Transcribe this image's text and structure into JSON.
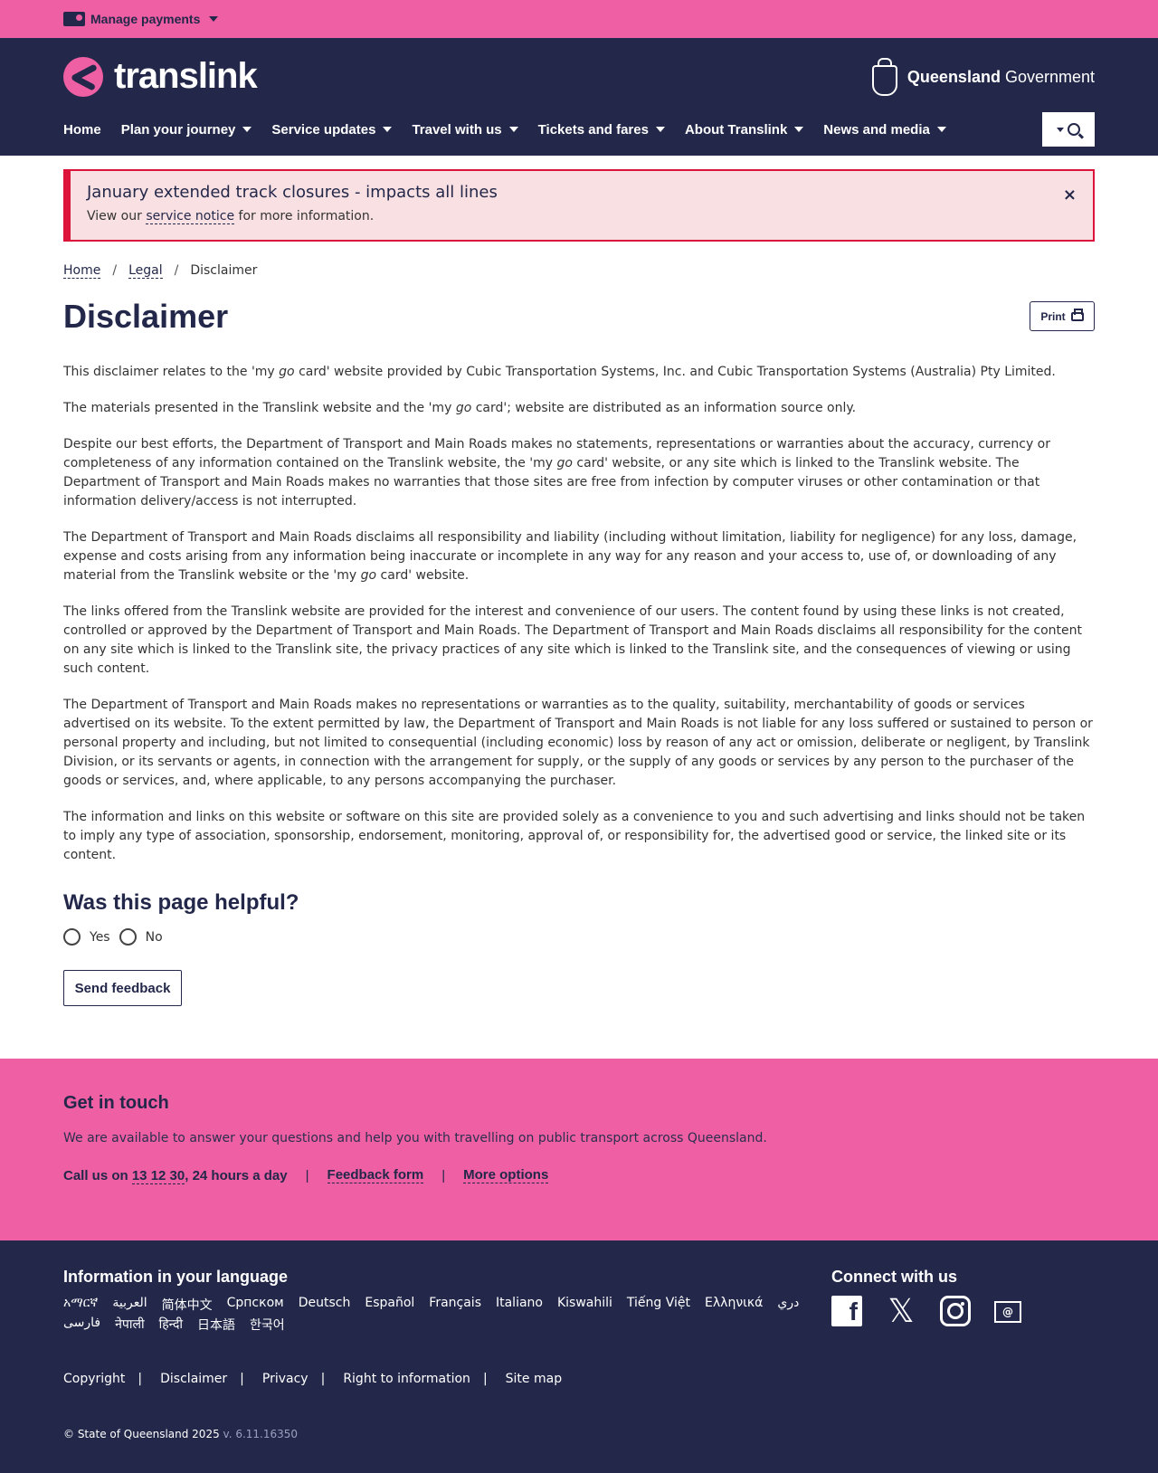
{
  "topbar": {
    "manage_payments": "Manage payments"
  },
  "header": {
    "logo_text": "translink",
    "gov_bold": "Queensland",
    "gov_rest": " Government",
    "nav": [
      {
        "label": "Home",
        "has_dropdown": false
      },
      {
        "label": "Plan your journey",
        "has_dropdown": true
      },
      {
        "label": "Service updates",
        "has_dropdown": true
      },
      {
        "label": "Travel with us",
        "has_dropdown": true
      },
      {
        "label": "Tickets and fares",
        "has_dropdown": true
      },
      {
        "label": "About Translink",
        "has_dropdown": true
      },
      {
        "label": "News and media",
        "has_dropdown": true
      }
    ]
  },
  "alert": {
    "title": "January extended track closures - impacts all lines",
    "body_prefix": "View our ",
    "link": "service notice",
    "body_suffix": " for more information.",
    "close": "×"
  },
  "breadcrumb": {
    "home": "Home",
    "legal": "Legal",
    "current": "Disclaimer",
    "sep": "/"
  },
  "page": {
    "title": "Disclaimer",
    "print_label": "Print",
    "paragraphs": [
      [
        "This disclaimer relates to the 'my ",
        "go",
        " card' website provided by Cubic Transportation Systems, Inc. and Cubic Transportation Systems (Australia) Pty Limited."
      ],
      [
        "The materials presented in the Translink website and the 'my ",
        "go",
        " card'; website are distributed as an information source only."
      ],
      [
        "Despite our best efforts, the Department of Transport and Main Roads makes no statements, representations or warranties about the accuracy, currency or completeness of any information contained on the Translink website, the 'my ",
        "go",
        " card' website, or any site which is linked to the Translink website. The Department of Transport and Main Roads makes no warranties that those sites are free from infection by computer viruses or other contamination or that information delivery/access is not interrupted."
      ],
      [
        "The Department of Transport and Main Roads disclaims all responsibility and liability (including without limitation, liability for negligence) for any loss, damage, expense and costs arising from any information being inaccurate or incomplete in any way for any reason and your access to, use of, or downloading of any material from the Translink website or the 'my ",
        "go",
        " card' website."
      ],
      [
        "The links offered from the Translink website are provided for the interest and convenience of our users. The content found by using these links is not created, controlled or approved by the Department of Transport and Main Roads. The Department of Transport and Main Roads disclaims all responsibility for the content on any site which is linked to the Translink site, the privacy practices of any site which is linked to the Translink site, and the consequences of viewing or using such content.",
        "",
        ""
      ],
      [
        "The Department of Transport and Main Roads makes no representations or warranties as to the quality, suitability, merchantability of goods or services advertised on its website. To the extent permitted by law, the Department of Transport and Main Roads is not liable for any loss suffered or sustained to person or personal property and including, but not limited to consequential (including economic) loss by reason of any act or omission, deliberate or negligent, by Translink Division, or its servants or agents, in connection with the arrangement for supply, or the supply of any goods or services by any person to the purchaser of the goods or services, and, where applicable, to any persons accompanying the purchaser.",
        "",
        ""
      ],
      [
        "The information and links on this website or software on this site are provided solely as a convenience to you and such advertising and links should not be taken to imply any type of association, sponsorship, endorsement, monitoring, approval of, or responsibility for, the advertised good or service, the linked site or its content.",
        "",
        ""
      ]
    ]
  },
  "feedback": {
    "heading": "Was this page helpful?",
    "yes": "Yes",
    "no": "No",
    "send": "Send feedback"
  },
  "touch": {
    "heading": "Get in touch",
    "lead": "We are available to answer your questions and help you with travelling on public transport across Queensland.",
    "call_prefix": "Call us on ",
    "phone": "13 12 30",
    "call_suffix": ", 24 hours a day",
    "feedback_form": "Feedback form",
    "more_options": "More options",
    "sep": "|"
  },
  "footer": {
    "lang_heading": "Information in your language",
    "languages": [
      "አማርኛ",
      "العربية",
      "简体中文",
      "Српском",
      "Deutsch",
      "Español",
      "Français",
      "Italiano",
      "Kiswahili",
      "Tiếng Việt",
      "Ελληνικά",
      "دري",
      "فارسی",
      "नेपाली",
      "हिन्दी",
      "日本語",
      "한국어"
    ],
    "connect_heading": "Connect with us",
    "legal": [
      "Copyright",
      "Disclaimer",
      "Privacy",
      "Right to information",
      "Site map"
    ],
    "copyright": "© State of Queensland 2025",
    "version": " v. 6.11.16350"
  },
  "icons": {
    "card": "card-icon",
    "search": "search-icon",
    "print": "printer-icon",
    "facebook": "facebook-icon",
    "x": "x-icon",
    "instagram": "instagram-icon",
    "email": "email-icon"
  },
  "colors": {
    "pink": "#ef5fa3",
    "navy": "#23284a",
    "alert_bg": "#f9e1e3",
    "alert_border": "#dc143c"
  }
}
